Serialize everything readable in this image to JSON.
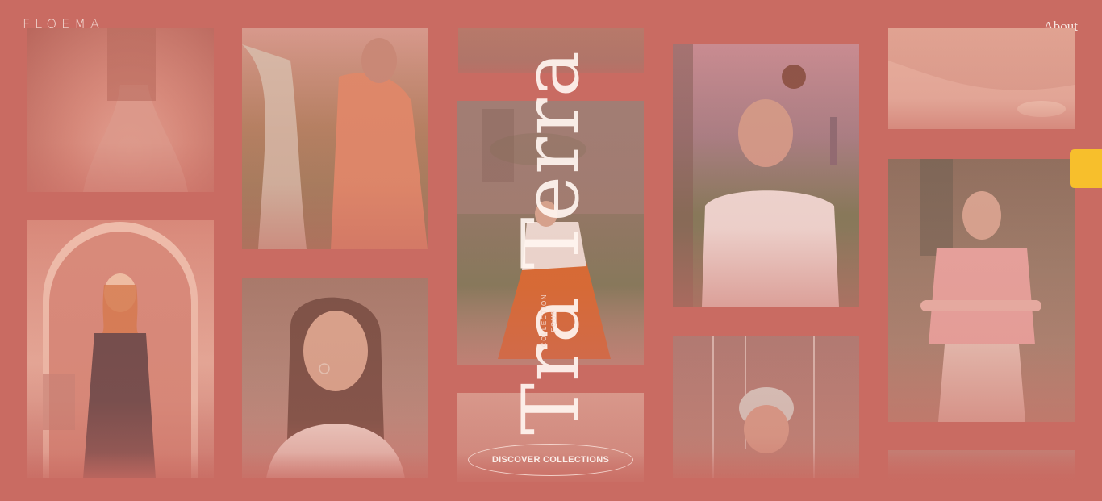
{
  "brand": {
    "logo": "FLOEMA"
  },
  "nav": {
    "about": "About"
  },
  "hero": {
    "title": "Tra Terra",
    "collection_line1": "COLLECTION",
    "collection_line2": "FOUR",
    "cta": "DISCOVER COLLECTIONS"
  },
  "gallery": [
    {
      "name": "photo-shoulders"
    },
    {
      "name": "photo-women-hillside"
    },
    {
      "name": "photo-woman-arch-doorway"
    },
    {
      "name": "photo-woman-portrait"
    },
    {
      "name": "photo-woman-orange-skirt"
    },
    {
      "name": "photo-woman-white-tee"
    },
    {
      "name": "photo-elder-woman"
    },
    {
      "name": "photo-hands-fabric"
    },
    {
      "name": "photo-woman-pink-shirt"
    }
  ],
  "colors": {
    "background": "#c96b62",
    "accent_tab": "#f7bf2c",
    "text_light": "#fbefea"
  }
}
